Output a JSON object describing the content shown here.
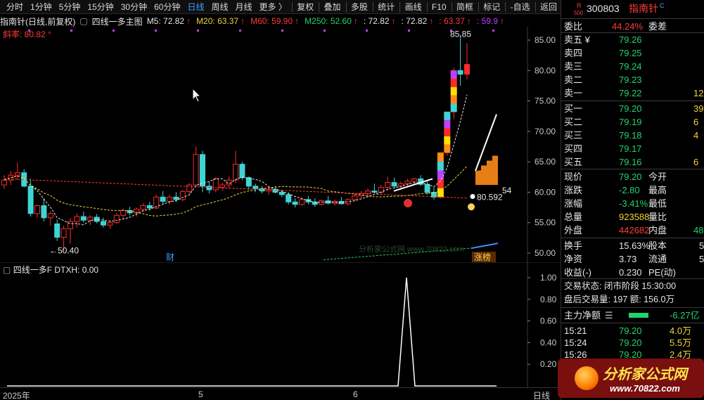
{
  "toolbar": {
    "items": [
      "分时",
      "1分钟",
      "5分钟",
      "15分钟",
      "30分钟",
      "60分钟",
      "日线",
      "周线",
      "月线",
      "更多 〉"
    ],
    "active_index": 6,
    "right_items": [
      "复权",
      "叠加",
      "多股",
      "统计",
      "画线",
      "F10",
      "简框",
      "标记",
      "-自选",
      "返回"
    ]
  },
  "main_chart": {
    "stock_name": "指南针(日线,前复权)",
    "indicator_title": "四线一多主图",
    "ma": [
      {
        "label": "M5: 72.82",
        "color": "#e6e6e6"
      },
      {
        "label": "M20: 63.37",
        "color": "#f0d43a"
      },
      {
        "label": "M60: 59.90",
        "color": "#ff3b3b"
      },
      {
        "label": "M250: 52.60",
        "color": "#22d36b"
      },
      {
        "label": ": 72.82",
        "color": "#e6e6e6"
      },
      {
        "label": ": 72.82",
        "color": "#e6e6e6"
      },
      {
        "label": ": 63.37",
        "color": "#ff3b3b"
      },
      {
        "label": ": 59.9",
        "color": "#c040ff"
      }
    ],
    "slope_label": "斜率: 80.82 °",
    "price_ticks": [
      "85.00",
      "80.00",
      "75.00",
      "70.00",
      "65.00",
      "60.00",
      "55.00",
      "50.00"
    ],
    "high_label": "85.85",
    "low_label": "←50.40",
    "mid_label1": "80.592",
    "mid_label2": "54",
    "tag_cai": "财",
    "tag_zhangbang": "涨榜",
    "watermark": "分析家公式网 www.70822.com"
  },
  "sub_chart": {
    "title": "四线一多F",
    "value_label": "DTXH: 0.00",
    "ticks": [
      "1.00",
      "0.80",
      "0.60",
      "0.40",
      "0.20"
    ]
  },
  "x_axis": {
    "labels": [
      "2025年",
      "5",
      "6"
    ],
    "period": "日线"
  },
  "chart_data": {
    "type": "candlestick",
    "title": "四线一多主图",
    "ylim": [
      48,
      87
    ],
    "candles": [
      [
        61.2,
        62.8,
        60.5,
        62.0
      ],
      [
        62.0,
        63.5,
        61.2,
        62.8
      ],
      [
        62.8,
        64.9,
        62.0,
        63.2
      ],
      [
        63.2,
        63.8,
        60.8,
        61.0
      ],
      [
        61.0,
        62.2,
        56.0,
        56.5
      ],
      [
        56.5,
        58.0,
        55.8,
        57.8
      ],
      [
        57.8,
        59.0,
        55.2,
        55.8
      ],
      [
        55.8,
        56.9,
        54.5,
        56.5
      ],
      [
        54.8,
        55.5,
        52.0,
        52.6
      ],
      [
        52.6,
        54.5,
        50.4,
        54.0
      ],
      [
        54.0,
        55.8,
        51.5,
        55.2
      ],
      [
        55.2,
        56.5,
        54.2,
        56.0
      ],
      [
        56.0,
        56.8,
        55.0,
        55.4
      ],
      [
        55.4,
        56.2,
        54.6,
        55.9
      ],
      [
        55.9,
        56.4,
        54.9,
        55.2
      ],
      [
        55.2,
        55.8,
        54.2,
        54.6
      ],
      [
        54.6,
        55.4,
        54.0,
        55.0
      ],
      [
        55.0,
        56.6,
        54.8,
        56.2
      ],
      [
        56.2,
        57.4,
        55.6,
        57.0
      ],
      [
        57.0,
        57.6,
        56.2,
        56.6
      ],
      [
        56.6,
        57.5,
        56.0,
        57.2
      ],
      [
        57.2,
        58.2,
        56.8,
        57.8
      ],
      [
        57.8,
        58.4,
        57.0,
        57.4
      ],
      [
        57.4,
        59.6,
        57.2,
        59.2
      ],
      [
        59.2,
        60.2,
        58.0,
        58.5
      ],
      [
        58.5,
        59.6,
        58.0,
        59.2
      ],
      [
        59.2,
        60.0,
        58.4,
        58.8
      ],
      [
        58.8,
        60.4,
        58.5,
        60.1
      ],
      [
        60.1,
        61.5,
        59.5,
        61.2
      ],
      [
        61.2,
        67.5,
        60.8,
        66.2
      ],
      [
        66.2,
        66.8,
        60.0,
        61.0
      ],
      [
        61.0,
        61.8,
        59.8,
        60.4
      ],
      [
        60.4,
        62.5,
        60.0,
        62.2
      ],
      [
        60.8,
        61.6,
        60.2,
        61.2
      ],
      [
        61.2,
        62.6,
        60.6,
        62.0
      ],
      [
        62.0,
        66.8,
        61.5,
        64.6
      ],
      [
        64.6,
        65.0,
        62.0,
        62.4
      ],
      [
        62.4,
        62.6,
        60.4,
        61.0
      ],
      [
        61.0,
        61.4,
        60.0,
        60.6
      ],
      [
        60.6,
        61.0,
        59.8,
        60.2
      ],
      [
        60.2,
        60.8,
        59.6,
        60.5
      ],
      [
        60.5,
        61.0,
        59.8,
        60.0
      ],
      [
        60.0,
        60.4,
        59.2,
        59.6
      ],
      [
        59.6,
        60.0,
        58.0,
        58.4
      ],
      [
        58.4,
        59.0,
        57.5,
        58.0
      ],
      [
        58.0,
        59.2,
        57.8,
        58.8
      ],
      [
        58.8,
        59.4,
        58.0,
        58.4
      ],
      [
        58.4,
        59.0,
        57.6,
        58.0
      ],
      [
        58.0,
        58.8,
        57.8,
        58.6
      ],
      [
        58.6,
        59.4,
        58.0,
        58.2
      ],
      [
        58.2,
        58.8,
        57.8,
        58.5
      ],
      [
        58.5,
        59.2,
        58.0,
        58.1
      ],
      [
        58.1,
        59.0,
        57.8,
        58.8
      ],
      [
        58.8,
        59.8,
        58.4,
        59.4
      ],
      [
        59.4,
        60.2,
        59.0,
        59.8
      ],
      [
        59.8,
        60.6,
        59.2,
        60.2
      ],
      [
        60.2,
        61.4,
        59.8,
        60.0
      ],
      [
        60.0,
        61.2,
        59.6,
        60.8
      ],
      [
        60.8,
        62.6,
        60.2,
        61.6
      ],
      [
        61.6,
        62.4,
        60.6,
        61.0
      ],
      [
        61.0,
        61.8,
        60.4,
        61.4
      ],
      [
        61.4,
        62.2,
        61.0,
        61.8
      ],
      [
        61.8,
        62.4,
        61.2,
        62.2
      ],
      [
        62.2,
        62.8,
        61.0,
        61.3
      ],
      [
        61.3,
        61.8,
        59.6,
        60.0
      ],
      [
        60.0,
        60.8,
        58.8,
        59.2
      ],
      [
        59.2,
        66.5,
        59.0,
        66.5
      ],
      [
        66.5,
        73.2,
        66.0,
        73.2
      ],
      [
        73.2,
        80.5,
        72.0,
        80.0
      ],
      [
        80.0,
        85.85,
        77.5,
        79.4
      ],
      [
        79.4,
        84.5,
        78.5,
        81.0
      ]
    ],
    "sub_series": {
      "name": "DTXH",
      "values_peak_index": 63,
      "peak": 1.0
    }
  },
  "right_panel": {
    "code": "300803",
    "name": "指南针",
    "badge": "R",
    "badge_sub": "500",
    "superscript": "C",
    "weibi_label": "委比",
    "weibi_value": "44.24%",
    "weicha_label": "委差",
    "sell": [
      {
        "label": "卖五 ¥",
        "price": "79.26",
        "vol": ""
      },
      {
        "label": "卖四",
        "price": "79.25",
        "vol": ""
      },
      {
        "label": "卖三",
        "price": "79.24",
        "vol": ""
      },
      {
        "label": "卖二",
        "price": "79.23",
        "vol": ""
      },
      {
        "label": "卖一",
        "price": "79.22",
        "vol": "12"
      }
    ],
    "buy": [
      {
        "label": "买一",
        "price": "79.20",
        "vol": "39"
      },
      {
        "label": "买二",
        "price": "79.19",
        "vol": "6"
      },
      {
        "label": "买三",
        "price": "79.18",
        "vol": "4"
      },
      {
        "label": "买四",
        "price": "79.17",
        "vol": ""
      },
      {
        "label": "买五",
        "price": "79.16",
        "vol": "6"
      }
    ],
    "quote": [
      {
        "l1": "现价",
        "v1": "79.20",
        "c1": "green",
        "l2": "今开"
      },
      {
        "l1": "涨跌",
        "v1": "-2.80",
        "c1": "green",
        "l2": "最高"
      },
      {
        "l1": "涨幅",
        "v1": "-3.41%",
        "c1": "green",
        "l2": "最低"
      },
      {
        "l1": "总量",
        "v1": "923588",
        "c1": "yellow",
        "l2": "量比"
      },
      {
        "l1": "外盘",
        "v1": "442682",
        "c1": "red",
        "l2": "内盘",
        "v2": "48",
        "c2": "green"
      }
    ],
    "stats": [
      {
        "l1": "换手",
        "v1": "15.63%",
        "l2": "股本",
        "v2": "5"
      },
      {
        "l1": "净资",
        "v1": "3.73",
        "l2": "流通",
        "v2": "5"
      },
      {
        "l1": "收益(-)",
        "v1": "0.230",
        "l2": "PE(动)",
        "v2": ""
      }
    ],
    "trade_status": "交易状态: 闭市阶段 15:30:00",
    "after_hours": "盘后交易量: 197  额: 156.0万",
    "main_flow_label": "主力净额",
    "main_flow_value": "-6.27亿",
    "ticks": [
      {
        "time": "15:21",
        "price": "79.20",
        "vol": "4.0万"
      },
      {
        "time": "15:24",
        "price": "79.20",
        "vol": "5.5万"
      },
      {
        "time": "15:26",
        "price": "79.20",
        "vol": "2.4万"
      }
    ],
    "logo_t1": "分析家公式网",
    "logo_t2": "www.70822.com"
  }
}
